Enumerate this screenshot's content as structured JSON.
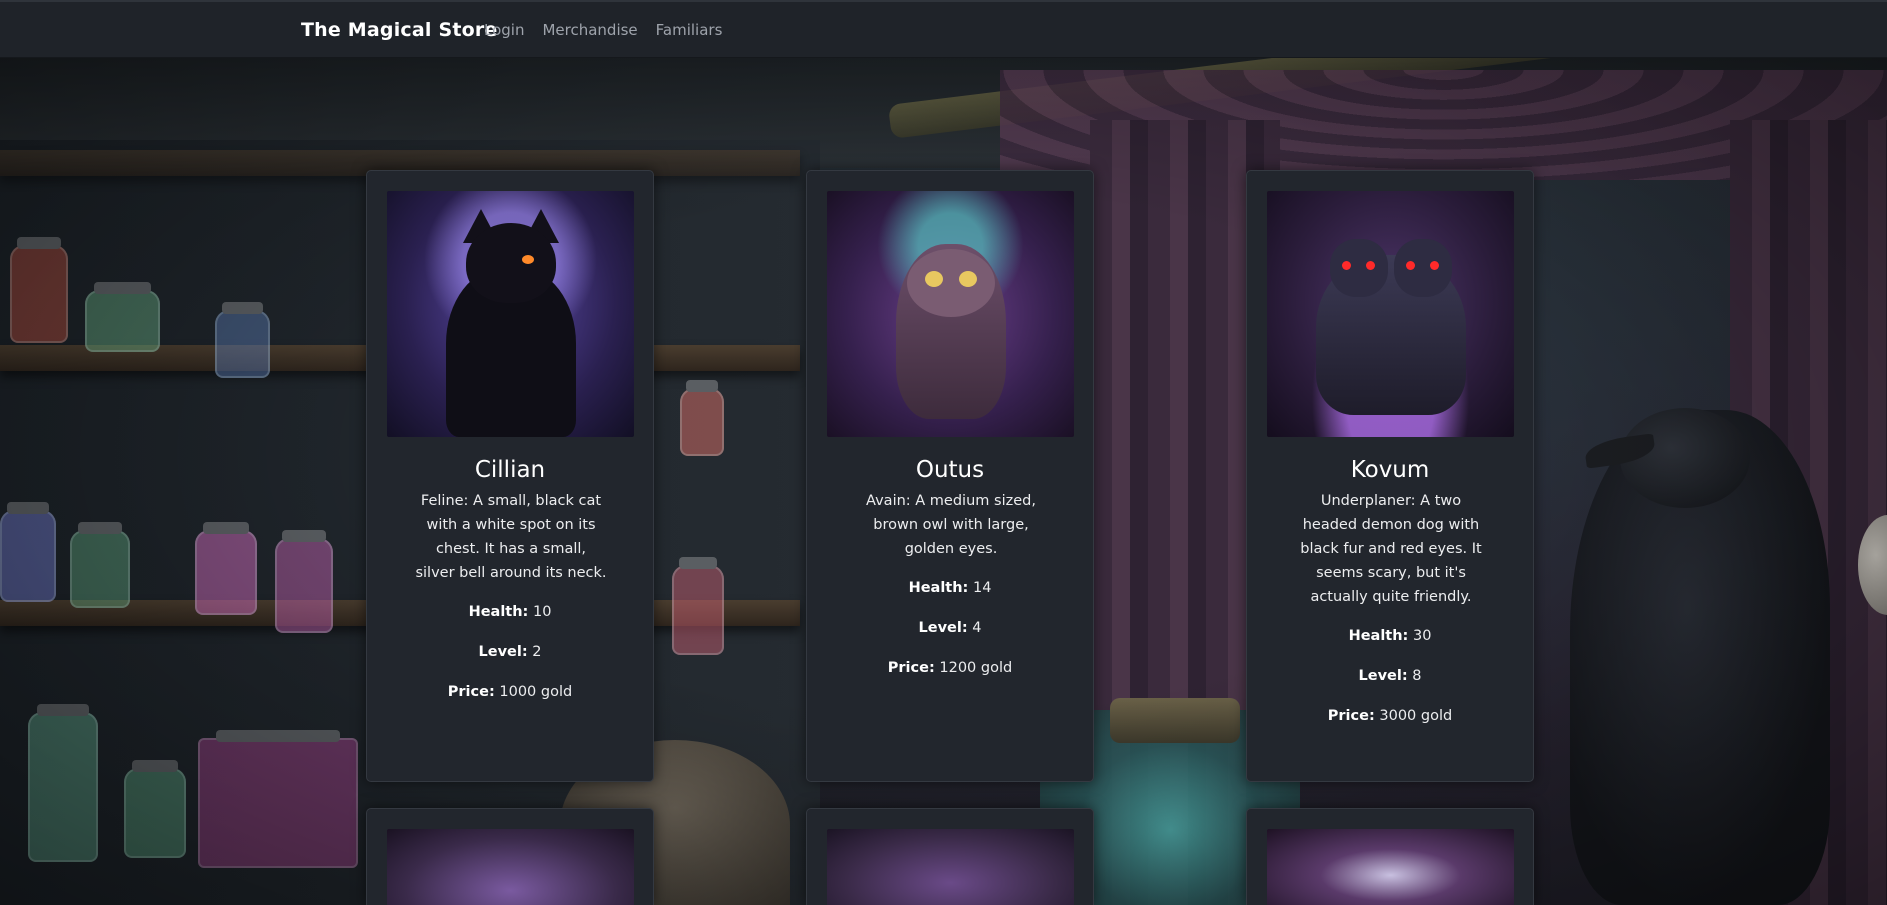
{
  "navbar": {
    "brand": "The Magical Store",
    "links": [
      "Login",
      "Merchandise",
      "Familiars"
    ]
  },
  "familiars": [
    {
      "name": "Cillian",
      "description": "Feline: A small, black cat with a white spot on its chest. It has a small, silver bell around its neck.",
      "health_label": "Health:",
      "health": "10",
      "level_label": "Level:",
      "level": "2",
      "price_label": "Price:",
      "price": "1000 gold"
    },
    {
      "name": "Outus",
      "description": "Avain: A medium sized, brown owl with large, golden eyes.",
      "health_label": "Health:",
      "health": "14",
      "level_label": "Level:",
      "level": "4",
      "price_label": "Price:",
      "price": "1200 gold"
    },
    {
      "name": "Kovum",
      "description": "Underplaner: A two headed demon dog with black fur and red eyes. It seems scary, but it's actually quite friendly.",
      "health_label": "Health:",
      "health": "30",
      "level_label": "Level:",
      "level": "8",
      "price_label": "Price:",
      "price": "3000 gold"
    }
  ]
}
